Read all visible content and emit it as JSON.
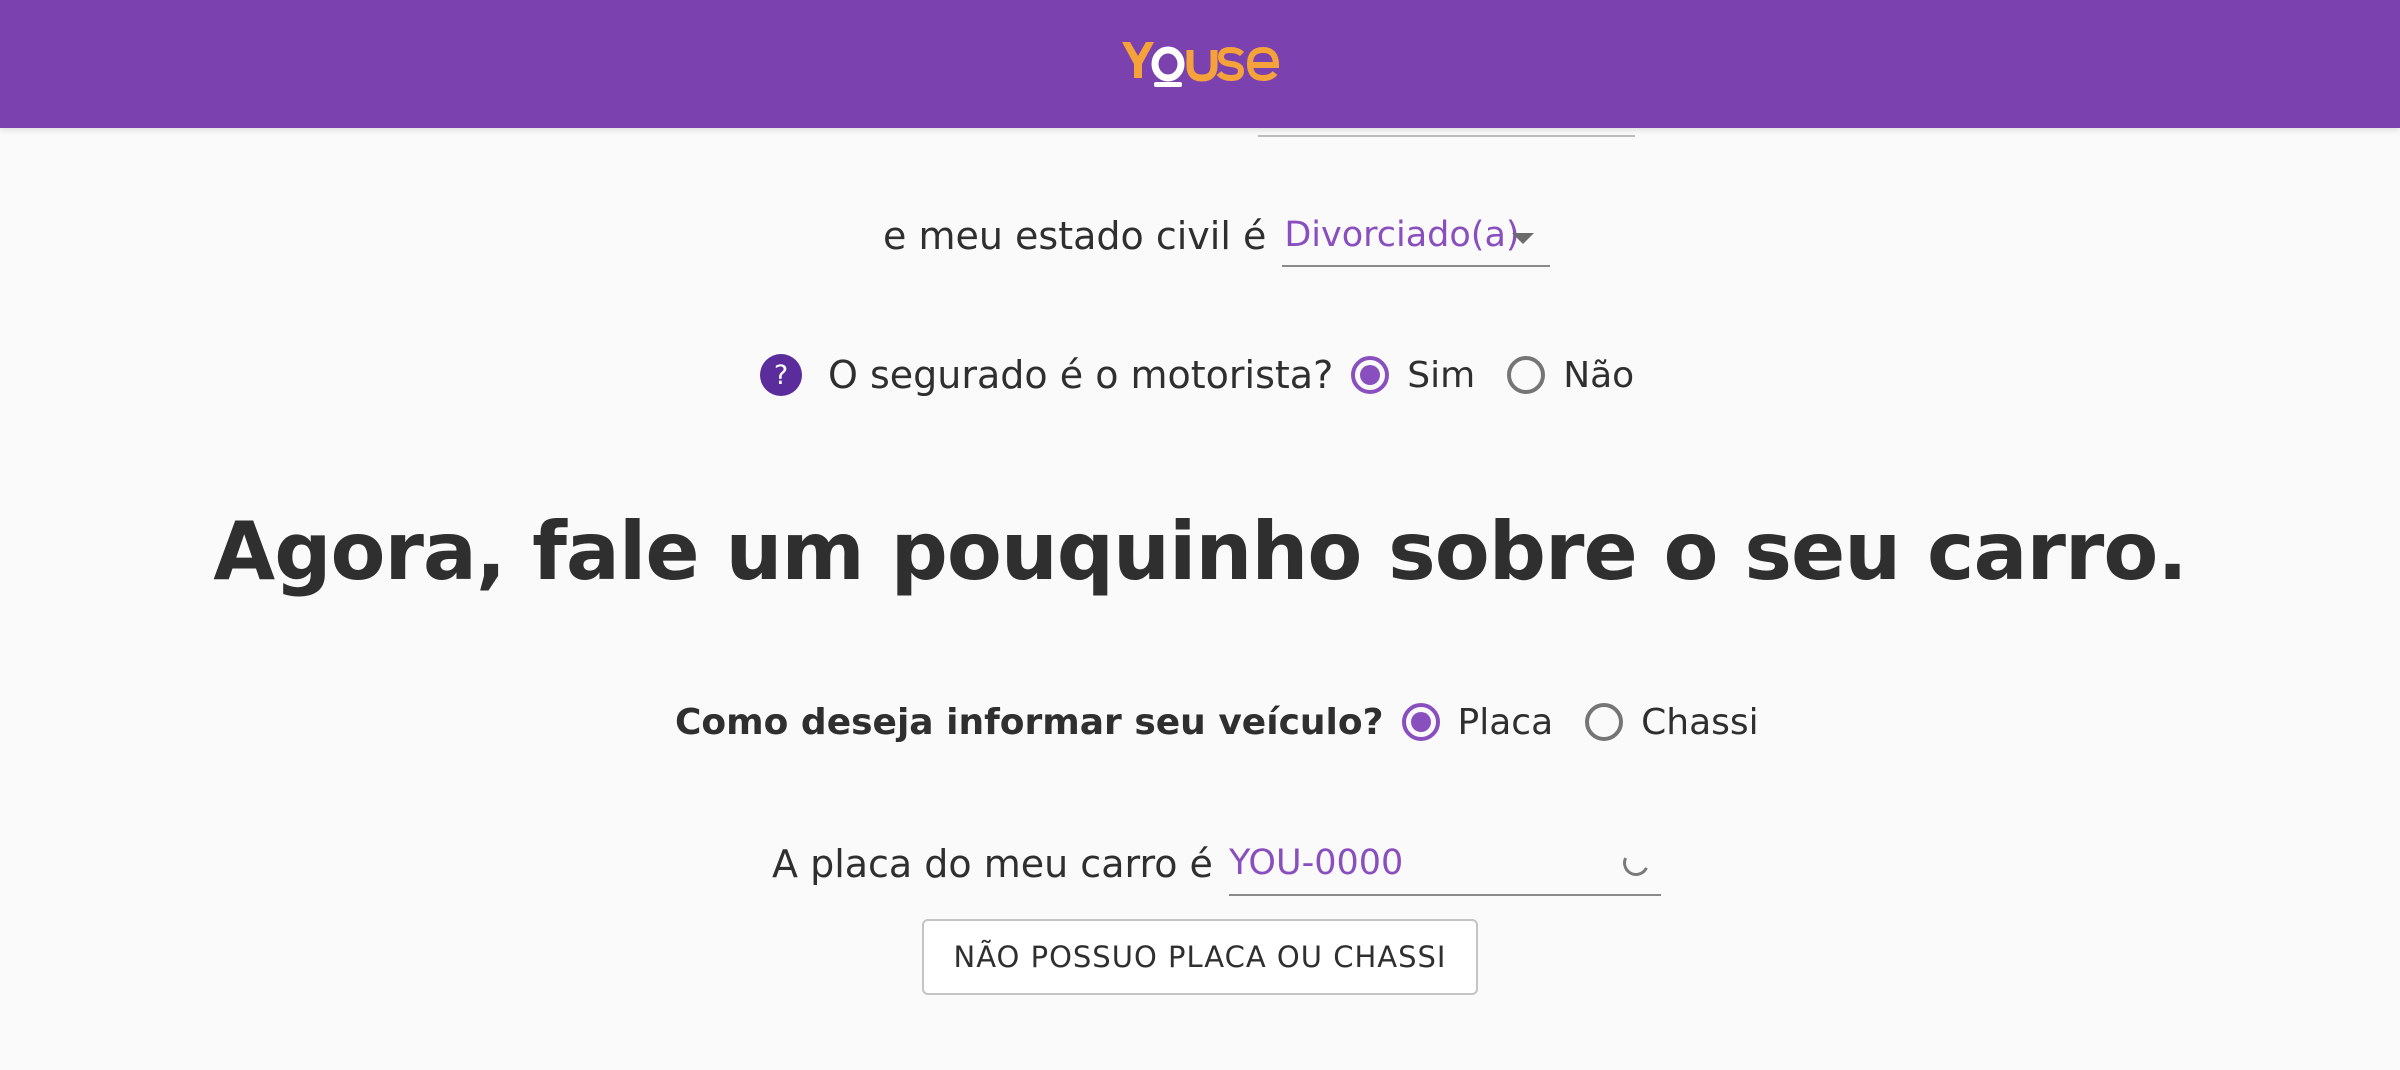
{
  "header": {
    "logo_text": "YOUSE",
    "background": "#7b42af",
    "logo_color": "#f6a23a",
    "logo_accent_color": "#ffffff"
  },
  "civil_status": {
    "label": "e meu estado civil é",
    "selected_value": "Divorciado(a)"
  },
  "driver_question": {
    "help_icon_glyph": "?",
    "label": "O segurado é o motorista?",
    "options": [
      {
        "label": "Sim",
        "checked": true
      },
      {
        "label": "Não",
        "checked": false
      }
    ]
  },
  "section_heading": "Agora, fale um pouquinho sobre o seu carro.",
  "vehicle_question": {
    "label": "Como deseja informar seu veículo?",
    "options": [
      {
        "label": "Placa",
        "checked": true
      },
      {
        "label": "Chassi",
        "checked": false
      }
    ]
  },
  "plate": {
    "label": "A placa do meu carro é",
    "placeholder": "YOU-0000",
    "value": ""
  },
  "no_plate_button_label": "NÃO POSSUO PLACA OU CHASSI",
  "colors": {
    "accent": "#8a4fbf",
    "help_icon": "#5b2d9c",
    "text": "#2f2f2f"
  }
}
